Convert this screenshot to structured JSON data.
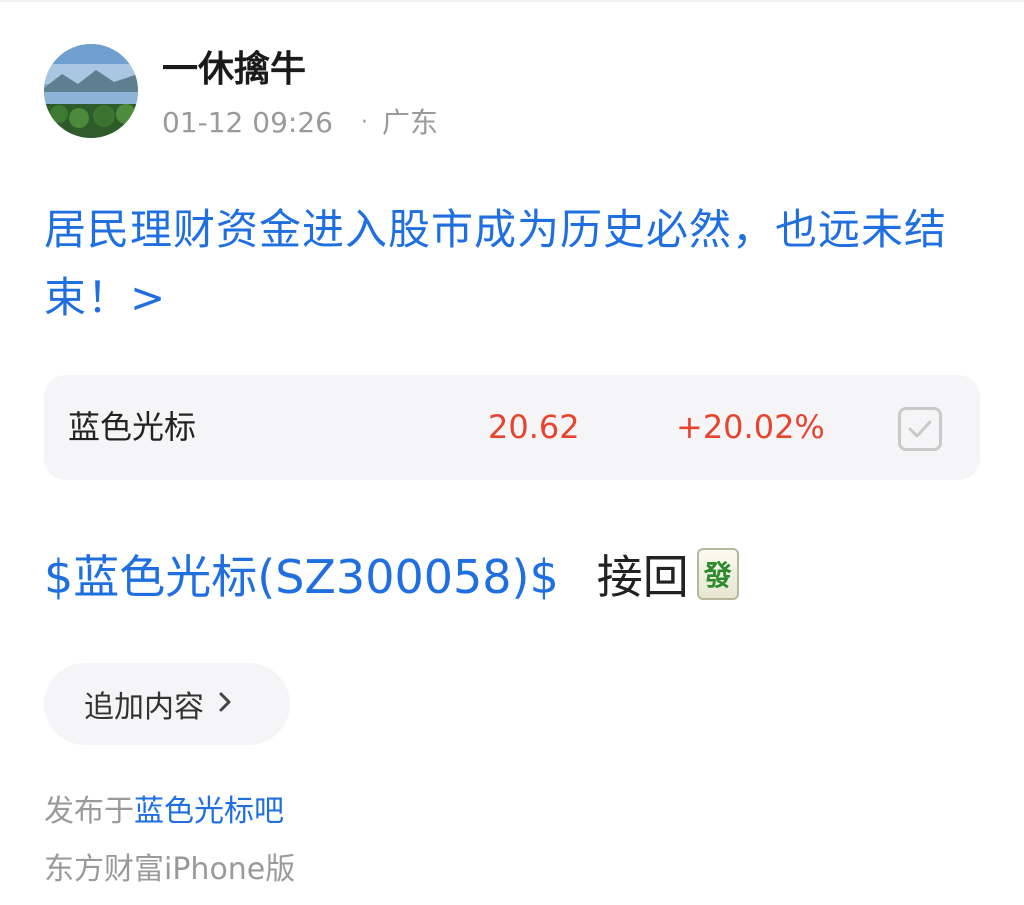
{
  "author": {
    "name": "一休擒牛",
    "time": "01-12 09:26",
    "location": "广东",
    "separator": "·"
  },
  "post": {
    "headline": "居民理财资金进入股市成为历史必然，也远未结束！>",
    "stock_card": {
      "name": "蓝色光标",
      "price": "20.62",
      "change": "+20.02%",
      "checkbox_icon": "checkbox-checked-icon"
    },
    "body": {
      "cashtag": "$蓝色光标(SZ300058)$",
      "text": "接回",
      "emoji": "發"
    }
  },
  "actions": {
    "add_content_label": "追加内容"
  },
  "footer": {
    "posted_prefix": "发布于",
    "bar_name": "蓝色光标吧",
    "client": "东方财富iPhone版"
  },
  "colors": {
    "link": "#1f6fe0",
    "up": "#e8432d",
    "muted": "#9a9a9a"
  }
}
